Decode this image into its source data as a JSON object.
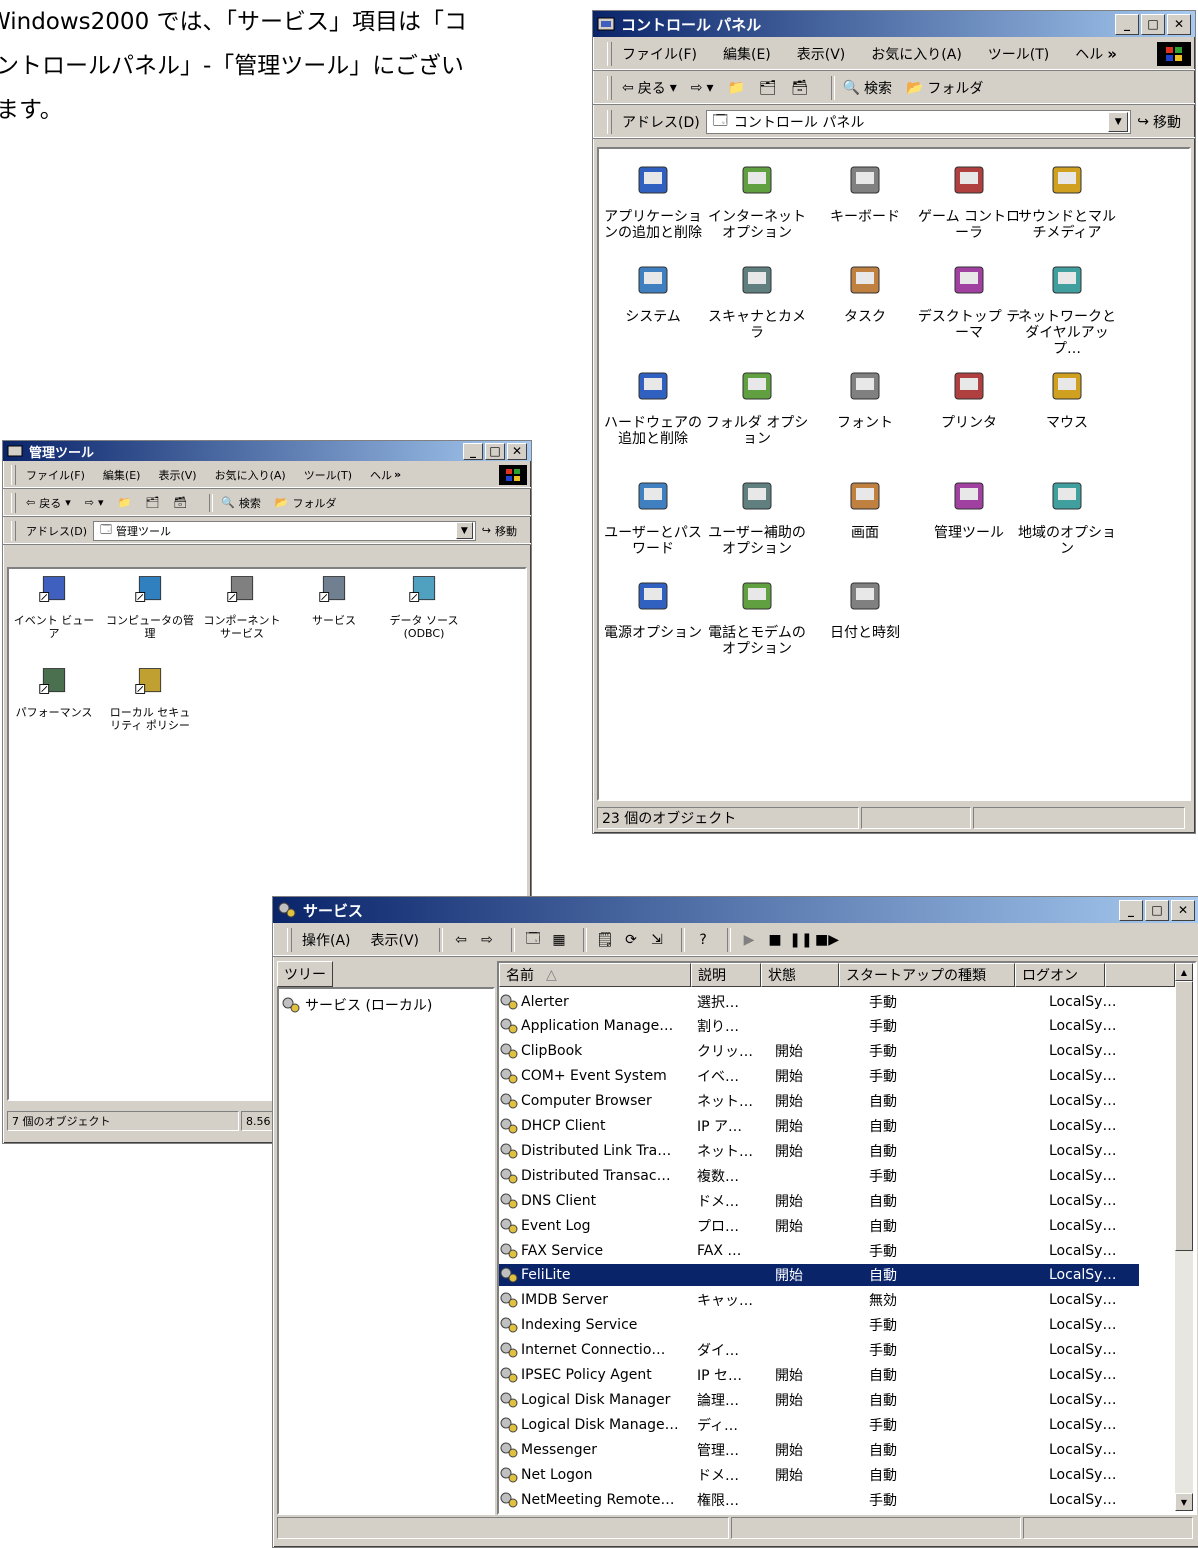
{
  "intro": {
    "line1": "Windows2000 では、「サービス」項目は「コ",
    "line2": "ントロールパネル」-「管理ツール」にござい",
    "line3": "ます。"
  },
  "control_panel": {
    "title": "コントロール パネル",
    "menu": [
      "ファイル(F)",
      "編集(E)",
      "表示(V)",
      "お気に入り(A)",
      "ツール(T)",
      "ヘル"
    ],
    "toolbar": {
      "back": "戻る",
      "search": "検索",
      "folders": "フォルダ"
    },
    "address_label": "アドレス(D)",
    "address_value": "コントロール パネル",
    "go_label": "移動",
    "items": [
      "アプリケーションの追加と削除",
      "インターネット オプション",
      "キーボード",
      "ゲーム コントローラ",
      "サウンドとマルチメディア",
      "システム",
      "スキャナとカメラ",
      "タスク",
      "デスクトップ テーマ",
      "ネットワークとダイヤルアップ…",
      "ハードウェアの追加と削除",
      "フォルダ オプション",
      "フォント",
      "プリンタ",
      "マウス",
      "ユーザーとパスワード",
      "ユーザー補助のオプション",
      "画面",
      "管理ツール",
      "地域のオプション",
      "電源オプション",
      "電話とモデムのオプション",
      "日付と時刻"
    ],
    "status": "23 個のオブジェクト"
  },
  "admin_tools": {
    "title": "管理ツール",
    "menu": [
      "ファイル(F)",
      "編集(E)",
      "表示(V)",
      "お気に入り(A)",
      "ツール(T)",
      "ヘル"
    ],
    "toolbar": {
      "back": "戻る",
      "search": "検索",
      "folders": "フォルダ"
    },
    "address_label": "アドレス(D)",
    "address_value": "管理ツール",
    "go_label": "移動",
    "items": [
      "イベント ビューア",
      "コンピュータの管理",
      "コンポーネント サービス",
      "サービス",
      "データ ソース (ODBC)",
      "パフォーマンス",
      "ローカル セキュリティ ポリシー"
    ],
    "status": "7 個のオブジェクト",
    "status_size": "8.56"
  },
  "services": {
    "title": "サービス",
    "menu": [
      "操作(A)",
      "表示(V)"
    ],
    "tree_tab": "ツリー",
    "tree_item": "サービス (ローカル)",
    "headers": [
      "名前",
      "説明",
      "状態",
      "スタートアップの種類",
      "ログオン"
    ],
    "rows": [
      {
        "name": "Alerter",
        "desc": "選択…",
        "state": "",
        "start": "手動",
        "logon": "LocalSy…"
      },
      {
        "name": "Application Manage…",
        "desc": "割り…",
        "state": "",
        "start": "手動",
        "logon": "LocalSy…"
      },
      {
        "name": "ClipBook",
        "desc": "クリッ…",
        "state": "開始",
        "start": "手動",
        "logon": "LocalSy…"
      },
      {
        "name": "COM+ Event System",
        "desc": "イベ…",
        "state": "開始",
        "start": "手動",
        "logon": "LocalSy…"
      },
      {
        "name": "Computer Browser",
        "desc": "ネット…",
        "state": "開始",
        "start": "自動",
        "logon": "LocalSy…"
      },
      {
        "name": "DHCP Client",
        "desc": "IP ア…",
        "state": "開始",
        "start": "自動",
        "logon": "LocalSy…"
      },
      {
        "name": "Distributed Link Tra…",
        "desc": "ネット…",
        "state": "開始",
        "start": "自動",
        "logon": "LocalSy…"
      },
      {
        "name": "Distributed Transac…",
        "desc": "複数…",
        "state": "",
        "start": "手動",
        "logon": "LocalSy…"
      },
      {
        "name": "DNS Client",
        "desc": "ドメ…",
        "state": "開始",
        "start": "自動",
        "logon": "LocalSy…"
      },
      {
        "name": "Event Log",
        "desc": "プロ…",
        "state": "開始",
        "start": "自動",
        "logon": "LocalSy…"
      },
      {
        "name": "FAX Service",
        "desc": "FAX …",
        "state": "",
        "start": "手動",
        "logon": "LocalSy…"
      },
      {
        "name": "FeliLite",
        "desc": "",
        "state": "開始",
        "start": "自動",
        "logon": "LocalSy…",
        "selected": true
      },
      {
        "name": "IMDB Server",
        "desc": "キャッ…",
        "state": "",
        "start": "無効",
        "logon": "LocalSy…"
      },
      {
        "name": "Indexing Service",
        "desc": "",
        "state": "",
        "start": "手動",
        "logon": "LocalSy…"
      },
      {
        "name": "Internet Connectio…",
        "desc": "ダイ…",
        "state": "",
        "start": "手動",
        "logon": "LocalSy…"
      },
      {
        "name": "IPSEC Policy Agent",
        "desc": "IP セ…",
        "state": "開始",
        "start": "自動",
        "logon": "LocalSy…"
      },
      {
        "name": "Logical Disk Manager",
        "desc": "論理…",
        "state": "開始",
        "start": "自動",
        "logon": "LocalSy…"
      },
      {
        "name": "Logical Disk Manage…",
        "desc": "ディ…",
        "state": "",
        "start": "手動",
        "logon": "LocalSy…"
      },
      {
        "name": "Messenger",
        "desc": "管理…",
        "state": "開始",
        "start": "自動",
        "logon": "LocalSy…"
      },
      {
        "name": "Net Logon",
        "desc": "ドメ…",
        "state": "開始",
        "start": "自動",
        "logon": "LocalSy…"
      },
      {
        "name": "NetMeeting Remote…",
        "desc": "権限…",
        "state": "",
        "start": "手動",
        "logon": "LocalSy…"
      }
    ]
  },
  "colors": {
    "titlebar": "#0a246a",
    "face": "#d4d0c8",
    "selection": "#0a246a"
  },
  "icons": [
    "gear-icon",
    "folder-icon",
    "search-icon",
    "back-arrow-icon",
    "forward-arrow-icon",
    "windows-logo-icon"
  ]
}
